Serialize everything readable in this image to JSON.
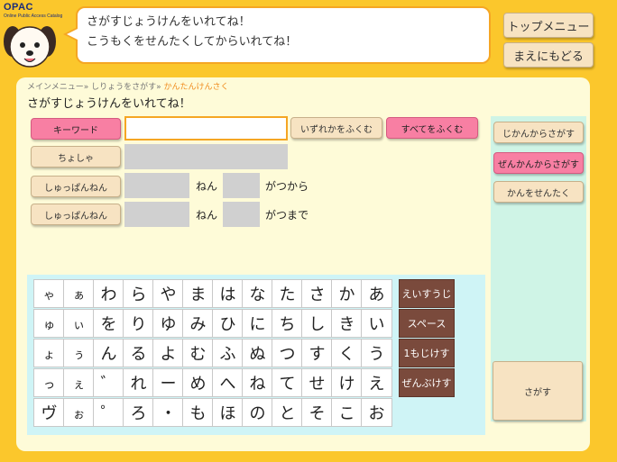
{
  "logo": {
    "name": "OPAC",
    "subtitle": "Online Public Access Catalog"
  },
  "header": {
    "message_line1": "さがすじょうけんをいれてね！",
    "message_line2": "こうもくをせんたくしてからいれてね！",
    "top_menu_label": "トップメニュー",
    "back_label": "まえにもどる"
  },
  "breadcrumb": {
    "home": "メインメニュー",
    "sep": "»",
    "search": "しりょうをさがす",
    "current": "かんたんけんさく"
  },
  "page_title": "さがすじょうけんをいれてね！",
  "form": {
    "keyword_label": "キーワード",
    "keyword_value": "",
    "any_label": "いずれかをふくむ",
    "all_label": "すべてをふくむ",
    "author_label": "ちょしゃ",
    "pubyear_label": "しゅっぱんねん",
    "year_unit": "ねん",
    "from_suffix": "がつから",
    "to_suffix": "がつまで"
  },
  "keyboard": {
    "rows": [
      [
        "ゃ",
        "ぁ",
        "わ",
        "ら",
        "や",
        "ま",
        "は",
        "な",
        "た",
        "さ",
        "か",
        "あ"
      ],
      [
        "ゅ",
        "ぃ",
        "を",
        "り",
        "ゆ",
        "み",
        "ひ",
        "に",
        "ち",
        "し",
        "き",
        "い"
      ],
      [
        "ょ",
        "ぅ",
        "ん",
        "る",
        "よ",
        "む",
        "ふ",
        "ぬ",
        "つ",
        "す",
        "く",
        "う"
      ],
      [
        "っ",
        "ぇ",
        "゛",
        "れ",
        "ー",
        "め",
        "へ",
        "ね",
        "て",
        "せ",
        "け",
        "え"
      ],
      [
        "ヴ",
        "ぉ",
        "゜",
        "ろ",
        "・",
        "も",
        "ほ",
        "の",
        "と",
        "そ",
        "こ",
        "お"
      ]
    ],
    "small_keys": [
      "ゃ",
      "ゅ",
      "ょ",
      "っ",
      "ぁ",
      "ぃ",
      "ぅ",
      "ぇ",
      "ぉ"
    ],
    "func_keys": [
      "えいすうじ",
      "スペース",
      "1もじけす",
      "ぜんぶけす"
    ]
  },
  "side": {
    "dict_label": "じかんからさがす",
    "field_label": "ぜんかんからさがす",
    "lib_label": "かんをせんたく",
    "search_label": "さがす"
  },
  "colors": {
    "background": "#fbc72c",
    "accent": "#f87fa3",
    "panel": "#fefbd8",
    "key_fn": "#7a4a3c"
  }
}
